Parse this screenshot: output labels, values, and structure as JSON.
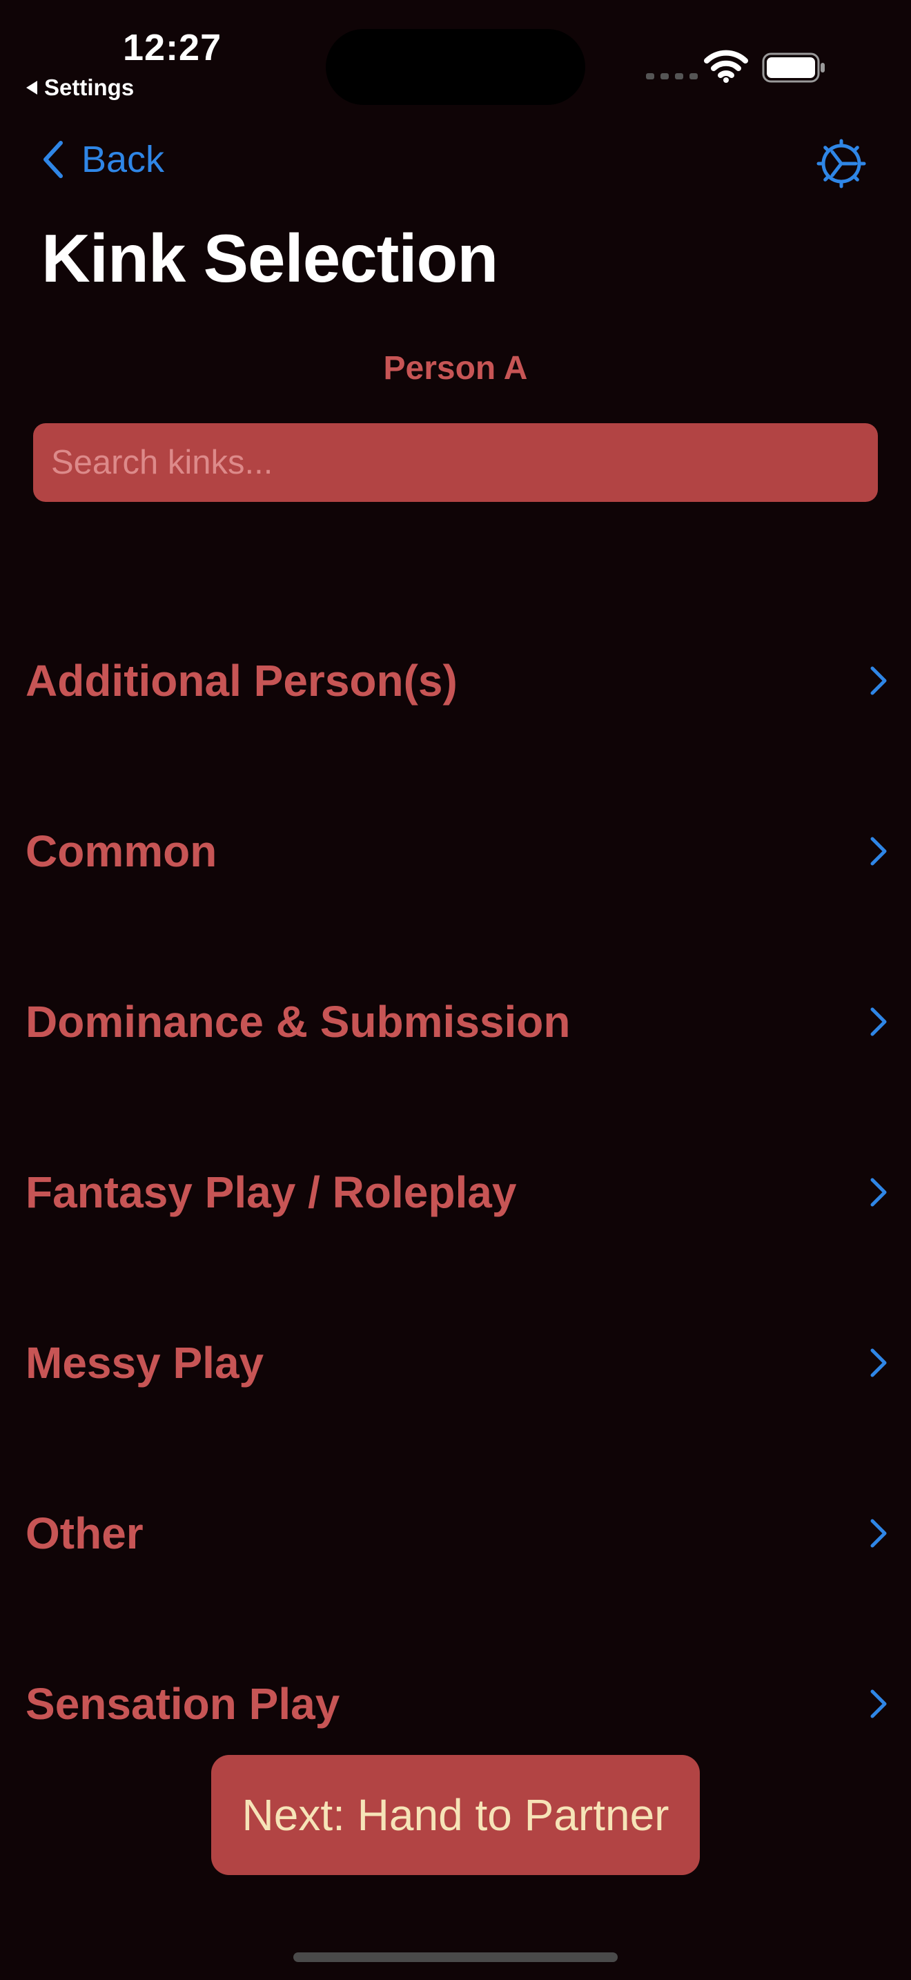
{
  "status_bar": {
    "time": "12:27",
    "back_app": "Settings"
  },
  "nav": {
    "back_label": "Back",
    "title": "Kink Selection"
  },
  "person_label": "Person A",
  "search": {
    "placeholder": "Search kinks...",
    "value": ""
  },
  "categories": [
    {
      "label": "Additional Person(s)"
    },
    {
      "label": "Common"
    },
    {
      "label": "Dominance & Submission"
    },
    {
      "label": "Fantasy Play / Roleplay"
    },
    {
      "label": "Messy Play"
    },
    {
      "label": "Other"
    },
    {
      "label": "Sensation Play"
    }
  ],
  "next_button_label": "Next: Hand to Partner",
  "colors": {
    "background": "#0f0406",
    "accent_red": "#c75555",
    "button_red": "#b24444",
    "link_blue": "#2f86e6",
    "button_text": "#f6e4b8"
  },
  "icons": {
    "back": "chevron-left-icon",
    "settings": "gear-icon",
    "row_disclosure": "chevron-right-icon"
  }
}
